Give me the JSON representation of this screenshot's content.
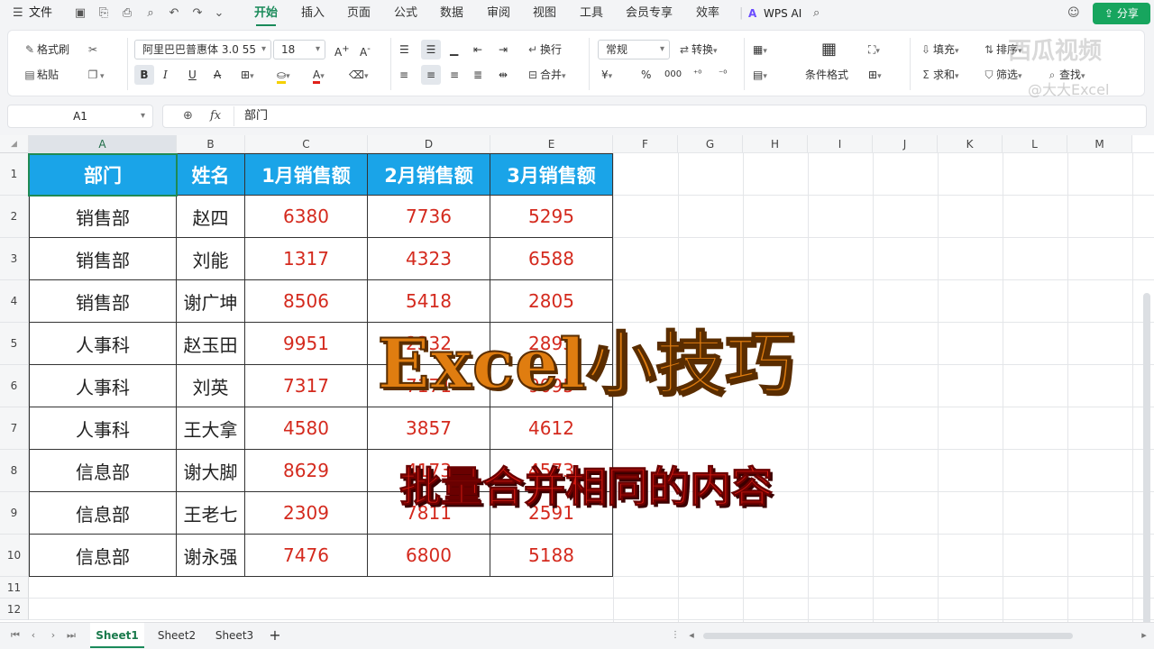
{
  "menubar": {
    "file": "文件",
    "items": [
      "开始",
      "插入",
      "页面",
      "公式",
      "数据",
      "审阅",
      "视图",
      "工具",
      "会员专享",
      "效率"
    ],
    "wps_ai": "WPS AI",
    "share": "分享"
  },
  "ribbon": {
    "format_painter": "格式刷",
    "paste": "粘贴",
    "font_name": "阿里巴巴普惠体 3.0 55",
    "font_size": "18",
    "wrap": "换行",
    "merge": "合并",
    "number_format": "常规",
    "convert": "转换",
    "cond_format": "条件格式",
    "fill": "填充",
    "sum": "求和",
    "filter": "筛选",
    "sort": "排序",
    "find": "查找"
  },
  "formula_bar": {
    "cell_ref": "A1",
    "fx": "fx",
    "content": "部门"
  },
  "columns": [
    "A",
    "B",
    "C",
    "D",
    "E",
    "F",
    "G",
    "H",
    "I",
    "J",
    "K",
    "L",
    "M"
  ],
  "rows": [
    "1",
    "2",
    "3",
    "4",
    "5",
    "6",
    "7",
    "8",
    "9",
    "10",
    "11",
    "12"
  ],
  "table": {
    "headers": [
      "部门",
      "姓名",
      "1月销售额",
      "2月销售额",
      "3月销售额"
    ],
    "rows": [
      [
        "销售部",
        "赵四",
        "6380",
        "7736",
        "5295"
      ],
      [
        "销售部",
        "刘能",
        "1317",
        "4323",
        "6588"
      ],
      [
        "销售部",
        "谢广坤",
        "8506",
        "5418",
        "2805"
      ],
      [
        "人事科",
        "赵玉田",
        "9951",
        "2332",
        "2893"
      ],
      [
        "人事科",
        "刘英",
        "7317",
        "7171",
        "9095"
      ],
      [
        "人事科",
        "王大拿",
        "4580",
        "3857",
        "4612"
      ],
      [
        "信息部",
        "谢大脚",
        "8629",
        "4173",
        "4573"
      ],
      [
        "信息部",
        "王老七",
        "2309",
        "7811",
        "2591"
      ],
      [
        "信息部",
        "谢永强",
        "7476",
        "6800",
        "5188"
      ]
    ]
  },
  "overlay": {
    "title": "Excel小技巧",
    "subtitle": "批量合并相同的内容"
  },
  "watermark": {
    "brand": "西瓜视频",
    "author": "@大大Excel"
  },
  "sheets": [
    "Sheet1",
    "Sheet2",
    "Sheet3"
  ],
  "add_sheet": "+",
  "colors": {
    "accent": "#1a8a5a",
    "header_fill": "#1aa4e8",
    "number_text": "#d42a1e",
    "title_orange": "#e07d10",
    "subtitle_red": "#d41a12"
  }
}
